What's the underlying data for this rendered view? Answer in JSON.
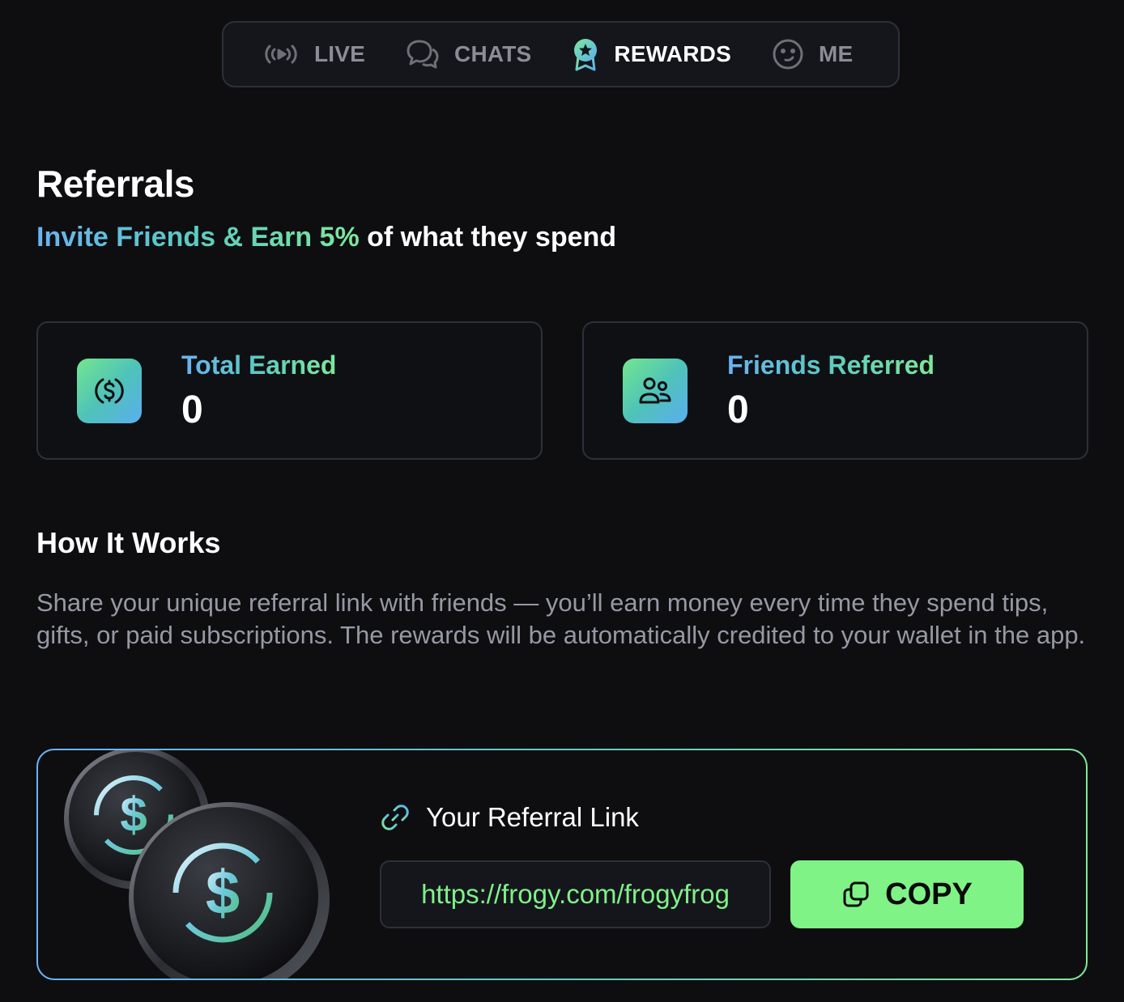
{
  "nav": {
    "items": [
      {
        "label": "LIVE",
        "icon": "live-broadcast-icon",
        "active": false
      },
      {
        "label": "CHATS",
        "icon": "chat-bubbles-icon",
        "active": false
      },
      {
        "label": "REWARDS",
        "icon": "award-ribbon-icon",
        "active": true
      },
      {
        "label": "ME",
        "icon": "smiley-face-icon",
        "active": false
      }
    ]
  },
  "page": {
    "title": "Referrals",
    "subtitle_highlight": "Invite Friends & Earn 5%",
    "subtitle_rest": " of what they spend"
  },
  "stats": {
    "total_earned": {
      "label": "Total Earned",
      "value": "0",
      "icon": "dollar-circle-icon"
    },
    "friends_referred": {
      "label": "Friends Referred",
      "value": "0",
      "icon": "users-icon"
    }
  },
  "how_it_works": {
    "title": "How It Works",
    "body": "Share your unique referral link with friends — you’ll earn money every time they spend tips, gifts, or paid subscriptions. The rewards will be automatically credited to your wallet in the app."
  },
  "referral": {
    "label": "Your Referral Link",
    "link": "https://frogy.com/frogyfrog",
    "copy_label": "COPY",
    "illustration": "dollar-coins-icon"
  },
  "colors": {
    "background": "#0e0e11",
    "accent_green": "#7ff386",
    "accent_blue": "#6ab2f2",
    "muted_text": "#9699a3"
  }
}
